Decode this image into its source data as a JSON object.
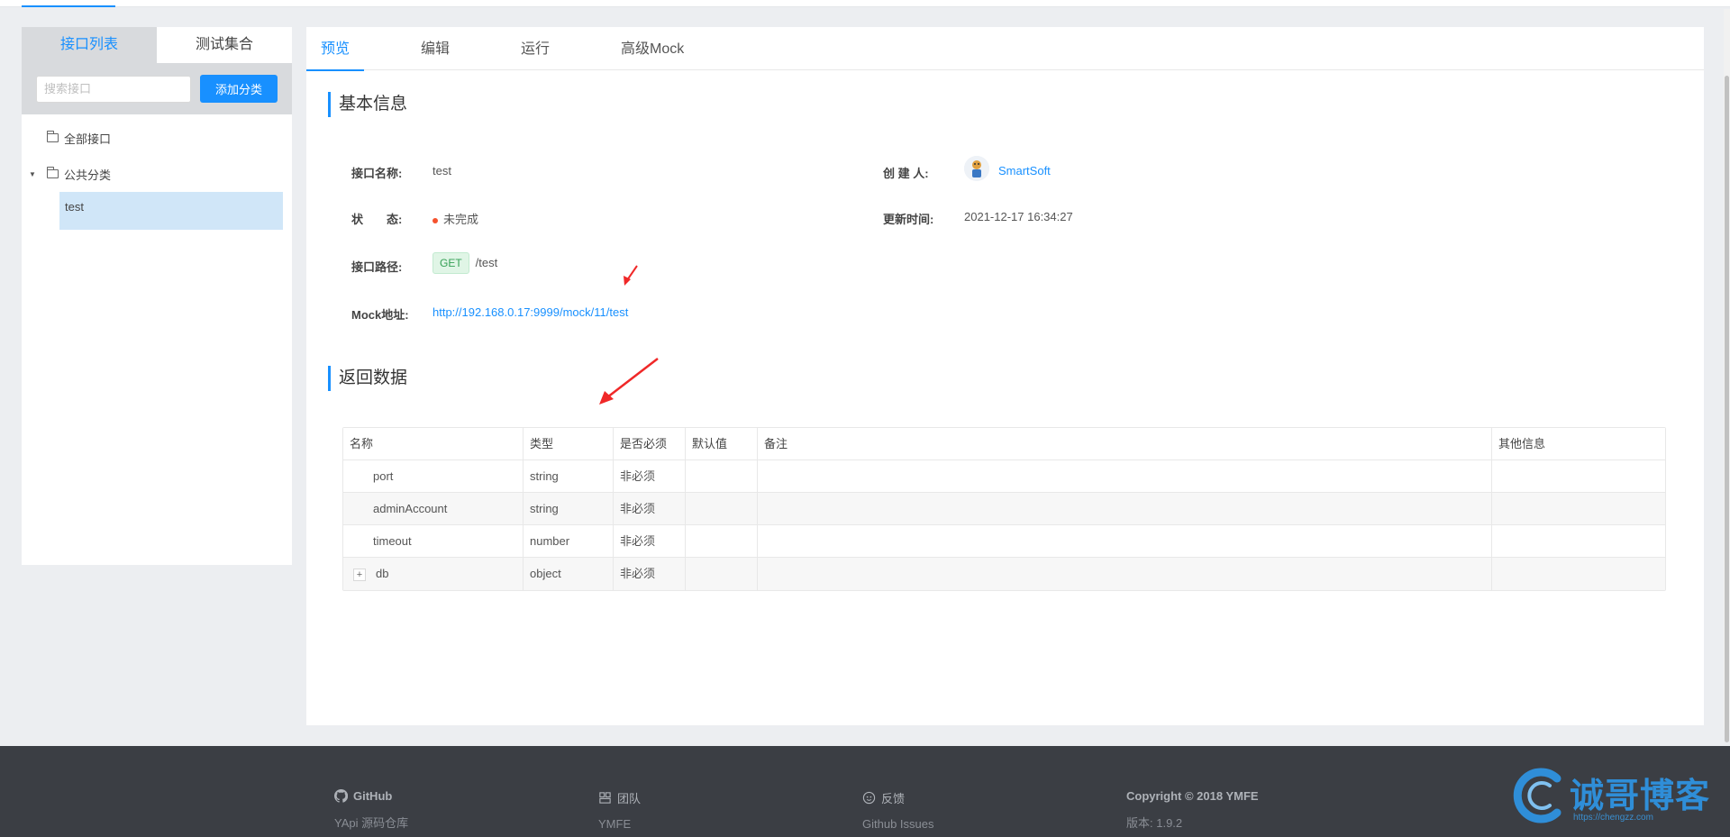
{
  "sidebar": {
    "tabs": [
      {
        "label": "接口列表"
      },
      {
        "label": "测试集合"
      }
    ],
    "search_placeholder": "搜索接口",
    "add_category_label": "添加分类",
    "tree": {
      "all": "全部接口",
      "category": "公共分类",
      "leaf": "test"
    }
  },
  "main": {
    "tabs": [
      {
        "label": "预览"
      },
      {
        "label": "编辑"
      },
      {
        "label": "运行"
      },
      {
        "label": "高级Mock"
      }
    ],
    "basic_info_title": "基本信息",
    "fields": {
      "name_label": "接口名称:",
      "name_value": "test",
      "creator_label": "创 建 人:",
      "creator_value": "SmartSoft",
      "status_label": "状　　态:",
      "status_value": "未完成",
      "updated_label": "更新时间:",
      "updated_value": "2021-12-17 16:34:27",
      "path_label": "接口路径:",
      "method": "GET",
      "path_value": "/test",
      "mock_label": "Mock地址:",
      "mock_value": "http://192.168.0.17:9999/mock/11/test"
    },
    "response_title": "返回数据",
    "table": {
      "headers": [
        "名称",
        "类型",
        "是否必须",
        "默认值",
        "备注",
        "其他信息"
      ],
      "rows": [
        {
          "name": "port",
          "type": "string",
          "required": "非必须",
          "default": "",
          "note": "",
          "other": ""
        },
        {
          "name": "adminAccount",
          "type": "string",
          "required": "非必须",
          "default": "",
          "note": "",
          "other": ""
        },
        {
          "name": "timeout",
          "type": "number",
          "required": "非必须",
          "default": "",
          "note": "",
          "other": ""
        },
        {
          "name": "db",
          "type": "object",
          "required": "非必须",
          "default": "",
          "note": "",
          "other": "",
          "expandable": "+"
        }
      ]
    }
  },
  "footer": {
    "github_title": "GitHub",
    "github_sub": "YApi 源码仓库",
    "team_title": "团队",
    "team_sub": "YMFE",
    "feedback_title": "反馈",
    "feedback_sub": "Github Issues",
    "copyright_title": "Copyright © 2018 YMFE",
    "version": "版本: 1.9.2"
  },
  "watermark": {
    "text": "诚哥博客",
    "url": "https://chengzz.com"
  },
  "colors": {
    "accent": "#1890ff",
    "status_dot": "#f5522d",
    "arrow": "#f02828",
    "footer_bg": "#3b3e44"
  }
}
